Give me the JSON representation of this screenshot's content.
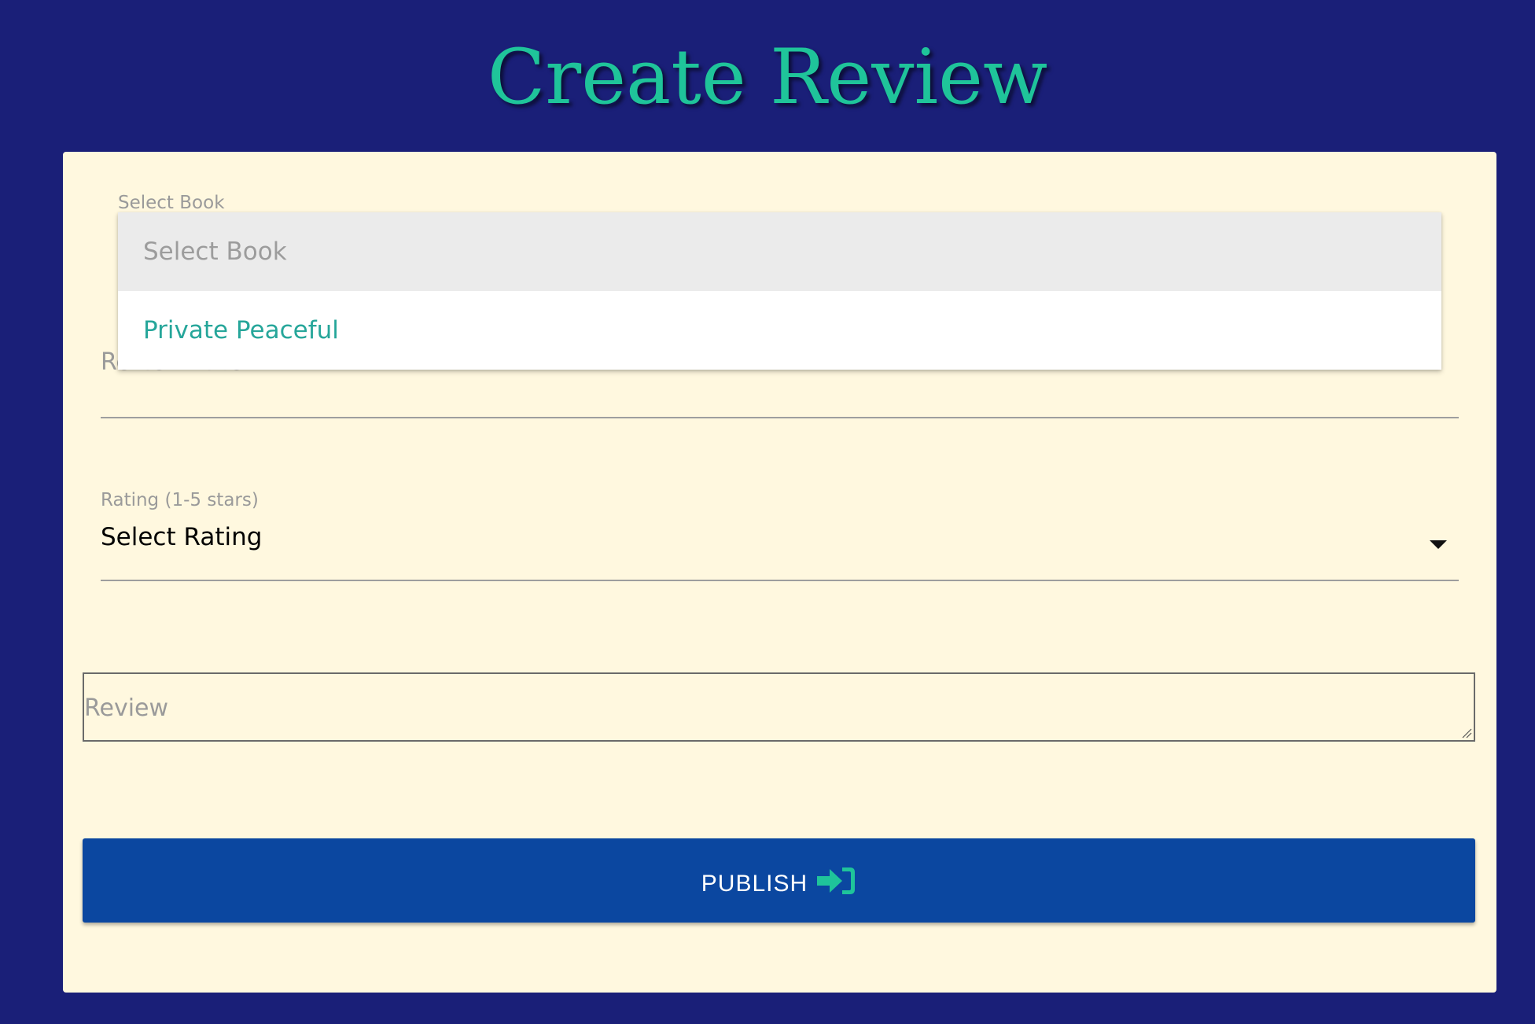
{
  "page": {
    "title": "Create Review"
  },
  "form": {
    "book_select": {
      "label": "Select Book",
      "options": [
        "Select Book",
        "Private Peaceful"
      ]
    },
    "review_title": {
      "placeholder": "Review Title"
    },
    "rating": {
      "label": "Rating (1-5 stars)",
      "selected": "Select Rating",
      "caret_icon": "caret-down-icon"
    },
    "review": {
      "placeholder": "Review"
    },
    "publish": {
      "label": "PUBLISH",
      "icon": "sign-in-icon"
    }
  },
  "colors": {
    "background": "#1a1f78",
    "card": "#fff8df",
    "title": "#1fc49a",
    "accent": "#26a69a",
    "button": "#0b47a0",
    "button_icon": "#1fc49a"
  }
}
